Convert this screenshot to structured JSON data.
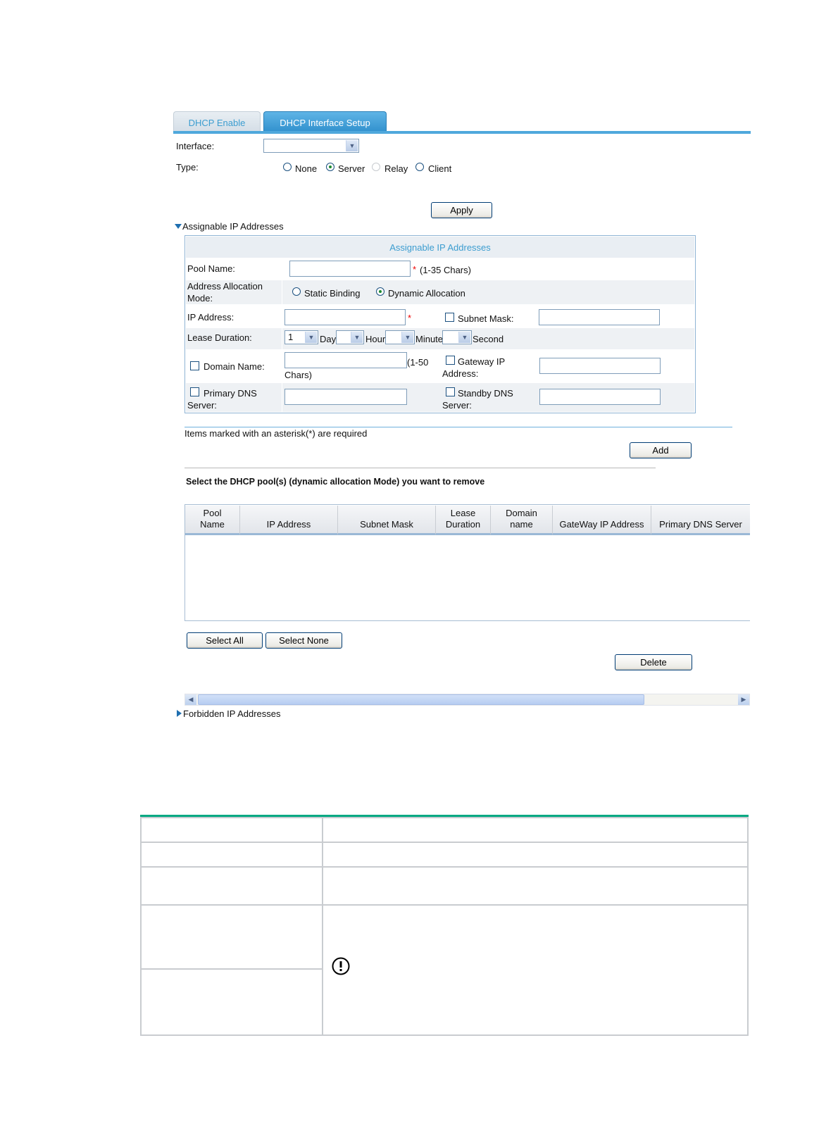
{
  "tabs": [
    {
      "label": "DHCP Enable",
      "active": false
    },
    {
      "label": "DHCP Interface Setup",
      "active": true
    }
  ],
  "interface": {
    "label": "Interface:",
    "value": ""
  },
  "type": {
    "label": "Type:",
    "options": [
      "None",
      "Server",
      "Relay",
      "Client"
    ],
    "selected": "Server",
    "disabled": "Relay"
  },
  "apply_label": "Apply",
  "assignable_section_label": "Assignable IP Addresses",
  "panel": {
    "title": "Assignable IP Addresses",
    "pool_name_label": "Pool Name:",
    "pool_name_hint": "(1-35 Chars)",
    "asterisk": "*",
    "alloc_mode_label_1": "Address Allocation",
    "alloc_mode_label_2": "Mode:",
    "alloc_static": "Static Binding",
    "alloc_dynamic": "Dynamic Allocation",
    "alloc_selected": "Dynamic Allocation",
    "ip_label": "IP Address:",
    "subnet_label": "Subnet Mask:",
    "lease_label": "Lease Duration:",
    "lease_day_value": "1",
    "day_label": "Day",
    "hour_label": "Hour",
    "minute_label": "Minute",
    "second_label": "Second",
    "domain_label": "Domain Name:",
    "domain_hint_1": "(1-50",
    "domain_hint_2": "Chars)",
    "gateway_label_1": "Gateway IP",
    "gateway_label_2": "Address:",
    "pdns_label_1": "Primary DNS",
    "pdns_label_2": "Server:",
    "sdns_label_1": "Standby DNS",
    "sdns_label_2": "Server:"
  },
  "required_note": "Items marked with an asterisk(*) are required",
  "add_label": "Add",
  "remove_prompt": "Select the DHCP pool(s) (dynamic allocation Mode) you want to remove",
  "grid_columns": [
    [
      "Pool",
      "Name"
    ],
    [
      "IP Address"
    ],
    [
      "Subnet Mask"
    ],
    [
      "Lease",
      "Duration"
    ],
    [
      "Domain",
      "name"
    ],
    [
      "GateWay IP Address"
    ],
    [
      "Primary DNS Server"
    ]
  ],
  "select_all_label": "Select All",
  "select_none_label": "Select None",
  "delete_label": "Delete",
  "forbidden_section_label": "Forbidden IP Addresses",
  "colors": {
    "tab_active": "#2f8fcc",
    "accent": "#4fa8dc",
    "table_top_rule": "#01a982"
  }
}
